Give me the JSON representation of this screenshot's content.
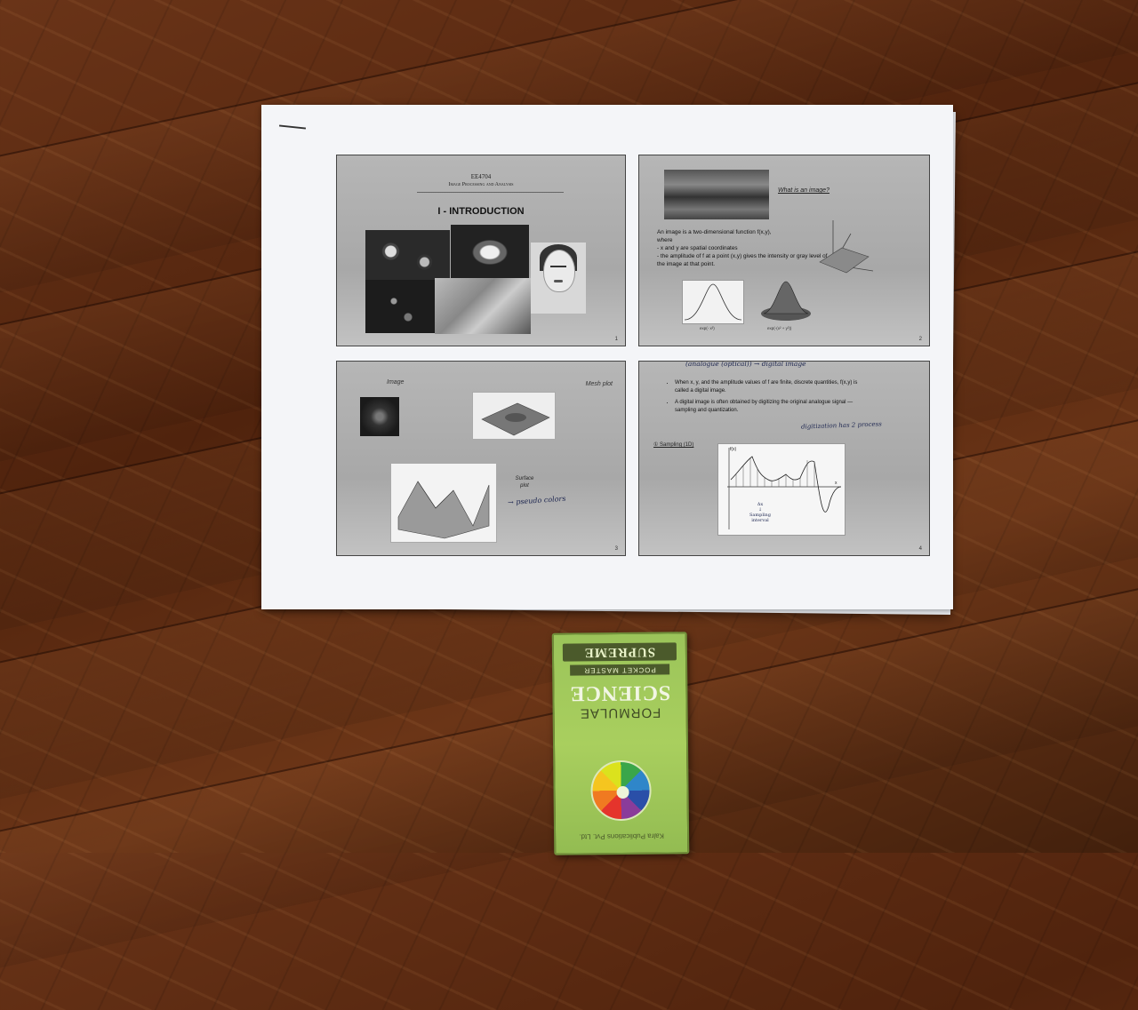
{
  "scene": "A printed set of four lecture slides lying on a wooden floor next to a small green pocket book",
  "slides": [
    {
      "number": "1",
      "course_code": "EE4704",
      "course_title": "Image Processing and Analysis",
      "heading": "I - INTRODUCTION"
    },
    {
      "number": "2",
      "question": "What is an image?",
      "definition_line1": "An image is a two-dimensional function f(x,y),",
      "definition_line2": "where",
      "definition_line3": "- x and y are spatial coordinates",
      "definition_line4": "- the amplitude of f at a point (x,y) gives the intensity or gray level of the image at that point.",
      "label_1d": "exp(- x²)",
      "label_2d": "exp(-(x² + y²))"
    },
    {
      "number": "3",
      "label_image": "Image",
      "label_mesh": "Mesh plot",
      "label_surface_1": "Surface",
      "label_surface_2": "plot",
      "handwritten_note": "→ pseudo colors"
    },
    {
      "number": "4",
      "handwritten_top": "(analogue (optical)) → digital image",
      "bullet_1": "When x, y, and the amplitude values of f are finite, discrete quantities, f(x,y) is called a digital image.",
      "bullet_2": "A digital image is often obtained by digitizing the original analogue signal — sampling and quantization.",
      "handwritten_right": "digitization has 2 process",
      "section": "① Sampling (1D)",
      "plot_ylabel": "f(x)",
      "plot_xlabel": "x",
      "handwritten_dx_1": "Δx",
      "handwritten_dx_2": "↓",
      "handwritten_dx_3": "Sampling",
      "handwritten_dx_4": "interval"
    }
  ],
  "book": {
    "publisher": "Kalra Publications Pvt. Ltd.",
    "subtitle": "FORMULAE",
    "title": "SCIENCE",
    "series": "POCKET MASTER",
    "brand": "SUPREME",
    "colors": {
      "cover": "#a9cf5e",
      "band": "#4b5a2b"
    }
  },
  "colors": {
    "floor": "#5a2a10",
    "paper": "#f4f5f8",
    "slide": "#b0b0b0",
    "ink": "#1d2650"
  }
}
